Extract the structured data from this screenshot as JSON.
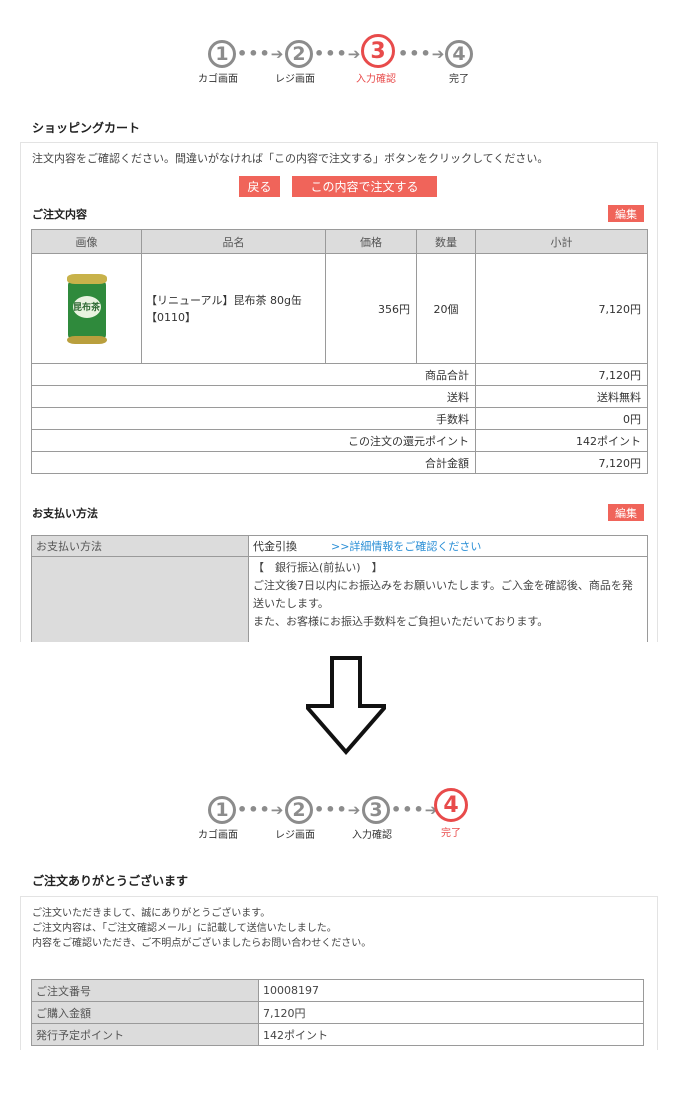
{
  "steps_before": {
    "items": [
      {
        "num": "1",
        "label": "カゴ画面",
        "active": false
      },
      {
        "num": "2",
        "label": "レジ画面",
        "active": false
      },
      {
        "num": "3",
        "label": "入力確認",
        "active": true
      },
      {
        "num": "4",
        "label": "完了",
        "active": false
      }
    ]
  },
  "cart": {
    "title": "ショッピングカート",
    "notice": "注文内容をご確認ください。間違いがなければ「この内容で注文する」ボタンをクリックしてください。",
    "back_label": "戻る",
    "order_label": "この内容で注文する",
    "order_section_title": "ご注文内容",
    "edit_label": "編集",
    "columns": [
      "画像",
      "品名",
      "価格",
      "数量",
      "小計"
    ],
    "item": {
      "image_text": "昆布茶",
      "name": "【リニューアル】昆布茶 80g缶 【0110】",
      "price": "356円",
      "quantity": "20個",
      "subtotal": "7,120円"
    },
    "summary": [
      {
        "label": "商品合計",
        "value": "7,120円"
      },
      {
        "label": "送料",
        "value": "送料無料"
      },
      {
        "label": "手数料",
        "value": "0円"
      },
      {
        "label": "この注文の還元ポイント",
        "value": "142ポイント"
      },
      {
        "label": "合計金額",
        "value": "7,120円"
      }
    ]
  },
  "payment": {
    "title": "お支払い方法",
    "edit_label": "編集",
    "header": "お支払い方法",
    "method": "代金引換",
    "detail_link": ">>詳細情報をご確認ください",
    "bank_title": "【　銀行振込(前払い)　】",
    "bank_text_1": "ご注文後7日以内にお振込みをお願いいたします。ご入金を確認後、商品を発送いたします。",
    "bank_text_2": "また、お客様にお振込手数料をご負担いただいております。"
  },
  "steps_after": {
    "items": [
      {
        "num": "1",
        "label": "カゴ画面",
        "active": false
      },
      {
        "num": "2",
        "label": "レジ画面",
        "active": false
      },
      {
        "num": "3",
        "label": "入力確認",
        "active": false
      },
      {
        "num": "4",
        "label": "完了",
        "active": true
      }
    ]
  },
  "thanks": {
    "title": "ご注文ありがとうございます",
    "line1": "ご注文いただきまして、誠にありがとうございます。",
    "line2": "ご注文内容は、「ご注文確認メール」に記載して送信いたしました。",
    "line3": "内容をご確認いただき、ご不明点がございましたらお問い合わせください。",
    "rows": [
      {
        "label": "ご注文番号",
        "value": "10008197"
      },
      {
        "label": "ご購入金額",
        "value": "7,120円"
      },
      {
        "label": "発行予定ポイント",
        "value": "142ポイント"
      }
    ]
  },
  "colors": {
    "accent": "#f0645a",
    "step_active": "#e84b4b",
    "step_inactive": "#8c8c8c",
    "link": "#2b8fd6"
  }
}
